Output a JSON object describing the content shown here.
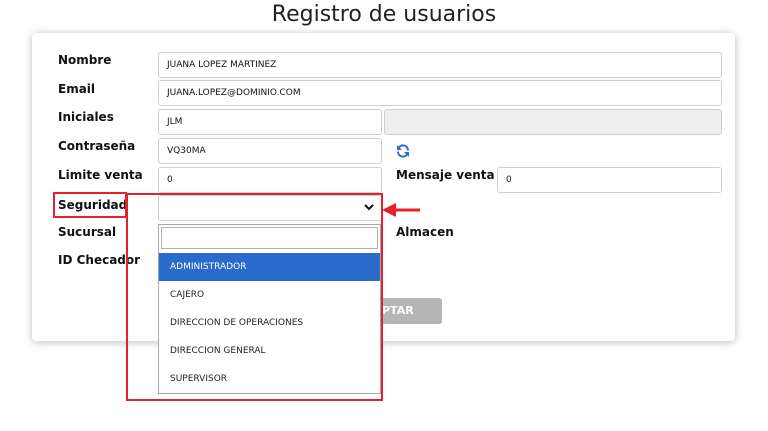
{
  "title": "Registro de usuarios",
  "form": {
    "nombre": {
      "label": "Nombre",
      "value": "JUANA LOPEZ MARTINEZ"
    },
    "email": {
      "label": "Email",
      "value": "JUANA.LOPEZ@DOMINIO.COM"
    },
    "iniciales": {
      "label": "Iniciales",
      "value": "JLM",
      "extra_value": ""
    },
    "contrasena": {
      "label": "Contraseña",
      "value": "VQ30MA"
    },
    "limite_venta": {
      "label": "Limite venta",
      "value": "0"
    },
    "mensaje_venta": {
      "label": "Mensaje venta",
      "value": "0"
    },
    "seguridad": {
      "label": "Seguridad",
      "selected": ""
    },
    "sucursal": {
      "label": "Sucursal"
    },
    "almacen": {
      "label": "Almacen"
    },
    "id_checador": {
      "label": "ID Checador"
    },
    "accept_label": "PTAR"
  },
  "dropdown": {
    "search_value": "",
    "options": [
      {
        "label": "ADMINISTRADOR",
        "selected": true
      },
      {
        "label": "CAJERO",
        "selected": false
      },
      {
        "label": "DIRECCION DE OPERACIONES",
        "selected": false
      },
      {
        "label": "DIRECCION GENERAL",
        "selected": false
      },
      {
        "label": "SUPERVISOR",
        "selected": false
      }
    ]
  },
  "colors": {
    "accent": "#2a6ccc",
    "highlight": "#e5212c",
    "button_disabled": "#b5b5b5"
  },
  "icons": {
    "refresh": "refresh-icon",
    "chevron": "chevron-down-icon",
    "arrow": "arrow-left-icon"
  }
}
